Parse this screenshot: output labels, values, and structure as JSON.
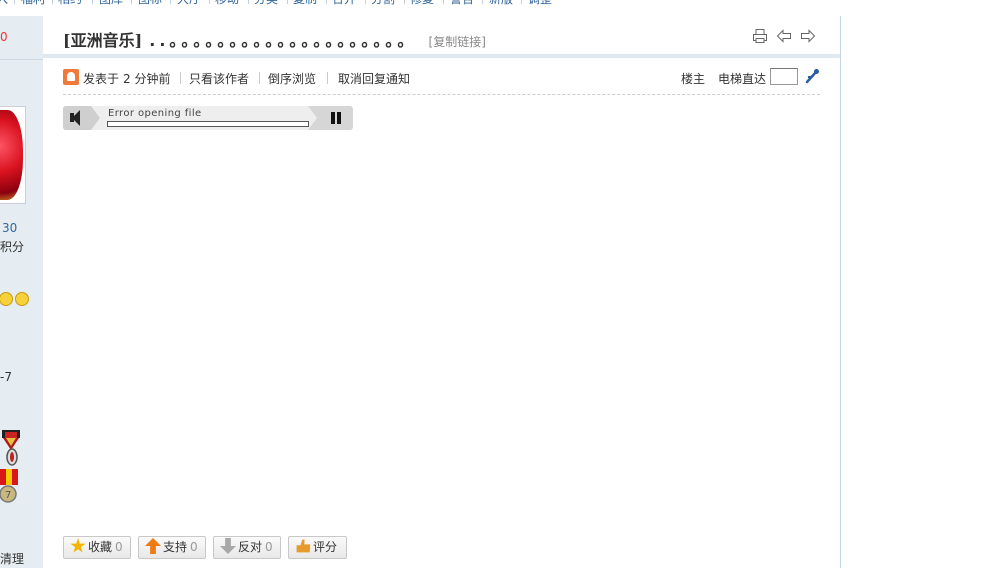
{
  "top_nav": {
    "items": [
      "入",
      "福利",
      "相约",
      "图库",
      "图标",
      "大厅",
      "移动",
      "分类",
      "复制",
      "合并",
      "分割",
      "修复",
      "警告",
      "新版",
      "调整"
    ]
  },
  "sidebar": {
    "red_value": "0",
    "stat_value": "30",
    "stat_label": "积分",
    "date_text": "-7",
    "footer_text": "清理"
  },
  "post": {
    "title": "[亚洲音乐]",
    "title_suffix": "..。。。。。。。。。。。。。。。。。。。。",
    "copy_link": "[复制链接]",
    "posted_prefix": "发表于",
    "posted_time": "2 分钟前",
    "only_author": "只看该作者",
    "reverse_order": "倒序浏览",
    "cancel_notify": "取消回复通知",
    "floor_label": "楼主",
    "jump_label": "电梯直达",
    "jump_input_value": ""
  },
  "player": {
    "message": "Error opening file",
    "progress": 0
  },
  "actions": [
    {
      "label": "收藏",
      "count": "0",
      "icon": "star-icon"
    },
    {
      "label": "支持",
      "count": "0",
      "icon": "thumb-up-arrow-icon"
    },
    {
      "label": "反对",
      "count": "0",
      "icon": "down-arrow-icon"
    },
    {
      "label": "评分",
      "count": "",
      "icon": "rate-hand-icon"
    }
  ],
  "colors": {
    "link": "#336699",
    "sidebar_bg": "#e5edf2",
    "accent_red": "#ee3333"
  }
}
